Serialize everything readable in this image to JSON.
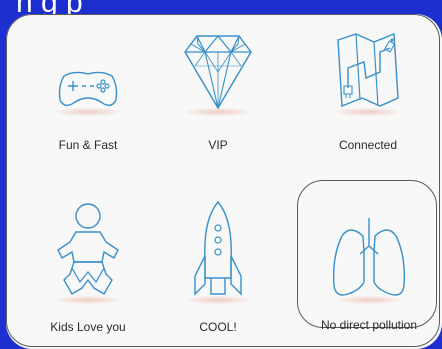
{
  "header": {
    "title": "h g p"
  },
  "features": [
    {
      "label": "Fun & Fast",
      "icon": "gamepad-icon"
    },
    {
      "label": "VIP",
      "icon": "diamond-icon"
    },
    {
      "label": "Connected",
      "icon": "map-connected-icon"
    },
    {
      "label": "Kids Love you",
      "icon": "baby-icon"
    },
    {
      "label": "COOL!",
      "icon": "rocket-icon"
    },
    {
      "label": "No direct pollution",
      "icon": "lungs-icon"
    }
  ],
  "colors": {
    "icon_stroke": "#3a8fc8",
    "background": "#f8f8f8",
    "frame": "#1e2fd0"
  }
}
